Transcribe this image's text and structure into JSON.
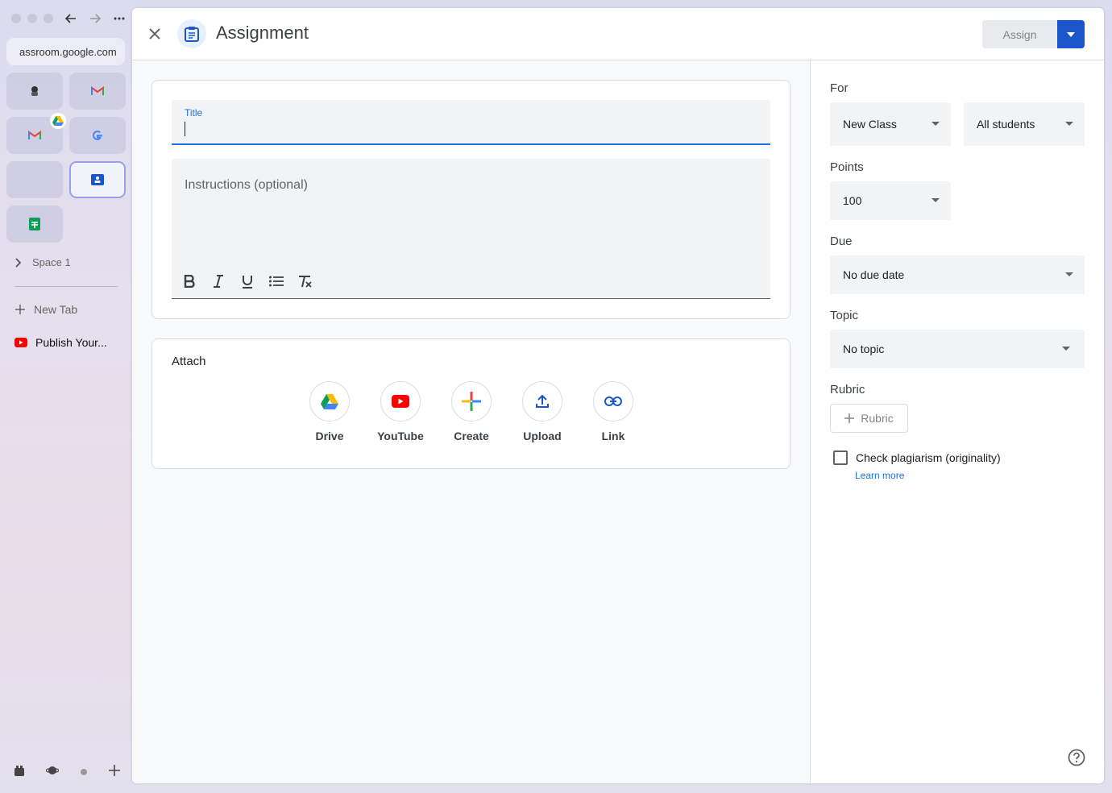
{
  "browser": {
    "url": "assroom.google.com",
    "space_label": "Space 1",
    "new_tab_label": "New Tab",
    "pinned_tab_label": "Publish Your..."
  },
  "header": {
    "title": "Assignment",
    "assign_label": "Assign"
  },
  "form": {
    "title_label": "Title",
    "title_value": "",
    "instructions_placeholder": "Instructions (optional)"
  },
  "attach": {
    "title": "Attach",
    "items": [
      {
        "label": "Drive",
        "icon": "drive-icon"
      },
      {
        "label": "YouTube",
        "icon": "youtube-icon"
      },
      {
        "label": "Create",
        "icon": "plus-icon"
      },
      {
        "label": "Upload",
        "icon": "upload-icon"
      },
      {
        "label": "Link",
        "icon": "link-icon"
      }
    ]
  },
  "settings": {
    "for_label": "For",
    "class_value": "New Class",
    "students_value": "All students",
    "points_label": "Points",
    "points_value": "100",
    "due_label": "Due",
    "due_value": "No due date",
    "topic_label": "Topic",
    "topic_value": "No topic",
    "rubric_label": "Rubric",
    "rubric_button": "Rubric",
    "plagiarism_label": "Check plagiarism (originality)",
    "learn_more": "Learn more"
  },
  "colors": {
    "accent": "#1a73e8",
    "assign_dropdown": "#1a56c9"
  }
}
